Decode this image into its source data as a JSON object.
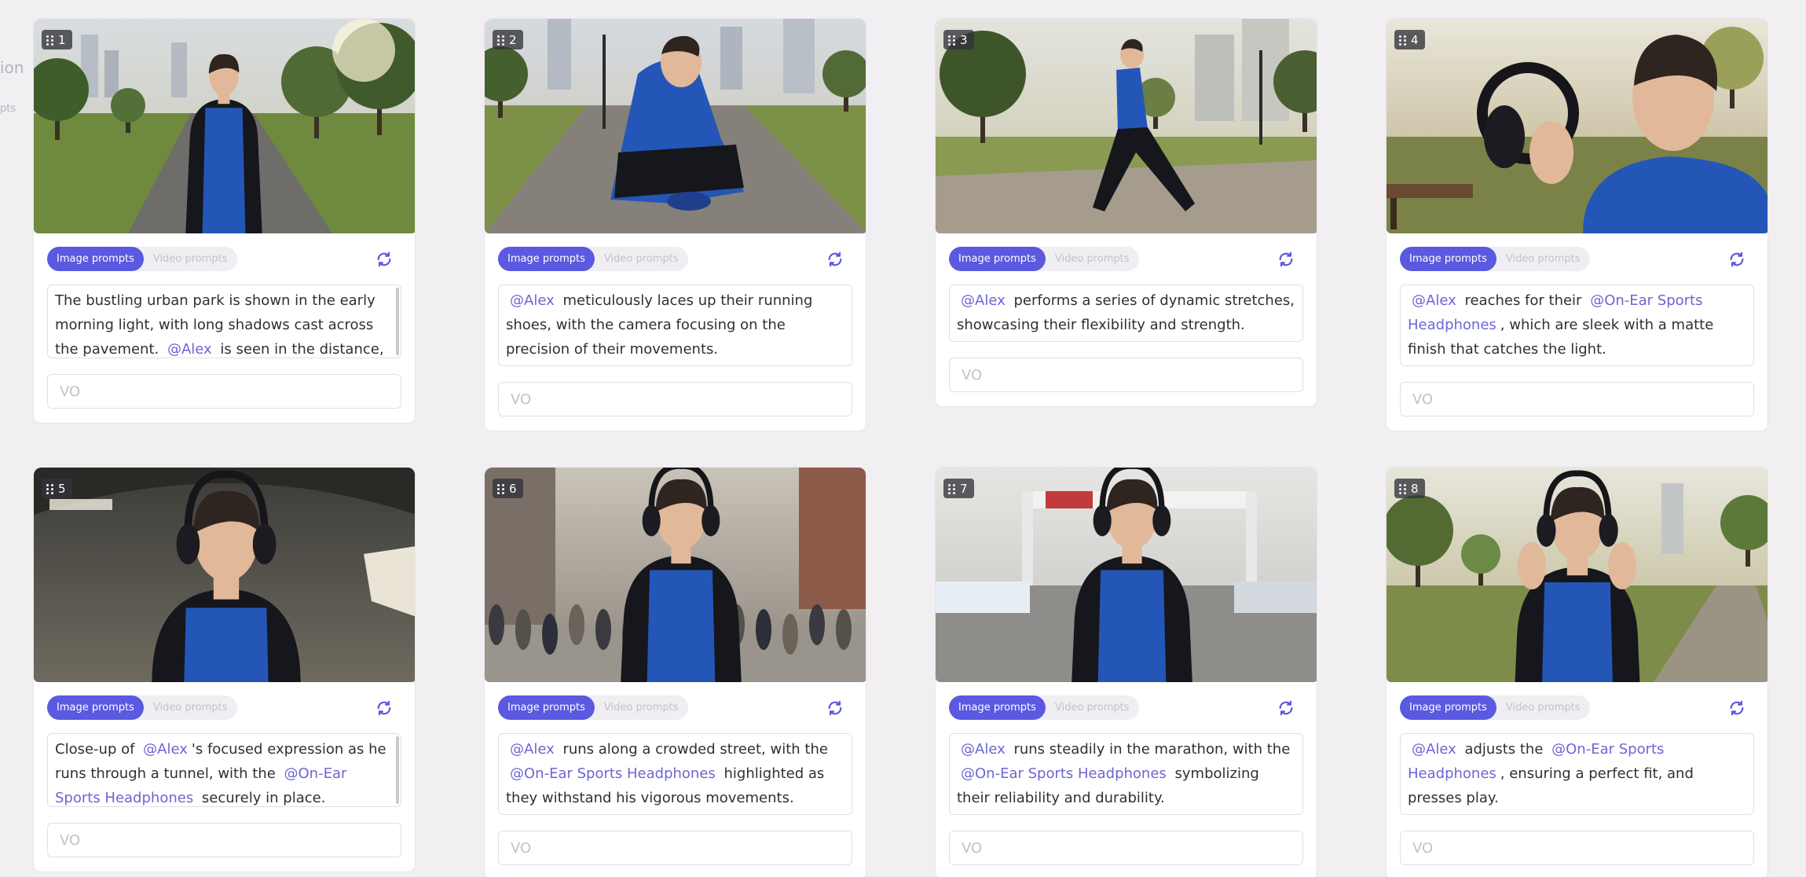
{
  "sidebar_fragments": [
    "ion",
    "pts"
  ],
  "tabs": {
    "image": "Image prompts",
    "video": "Video prompts"
  },
  "vo_placeholder": "VO",
  "colors": {
    "accent": "#5b59e0",
    "mention": "#6c66d2",
    "background": "#f1eff2"
  },
  "cards": [
    {
      "number": "1",
      "scene": "park-walk",
      "prompt": [
        {
          "t": "The bustling urban park is shown in the early morning light, with long shadows cast across the pavement. "
        },
        {
          "m": "@Alex"
        },
        {
          "t": " is seen in the distance,"
        }
      ]
    },
    {
      "number": "2",
      "scene": "tying-shoes",
      "prompt": [
        {
          "m": "@Alex"
        },
        {
          "t": " meticulously laces up their running shoes, with the camera focusing on the precision of their movements."
        }
      ]
    },
    {
      "number": "3",
      "scene": "stretching",
      "prompt": [
        {
          "m": "@Alex"
        },
        {
          "t": " performs a series of dynamic stretches, showcasing their flexibility and strength."
        }
      ]
    },
    {
      "number": "4",
      "scene": "holding-headphones",
      "prompt": [
        {
          "m": "@Alex"
        },
        {
          "t": " reaches for their "
        },
        {
          "m": "@On-Ear Sports Headphones"
        },
        {
          "t": ", which are sleek with a matte finish that catches the light."
        }
      ]
    },
    {
      "number": "5",
      "scene": "tunnel-closeup",
      "prompt": [
        {
          "t": "Close-up of "
        },
        {
          "m": "@Alex"
        },
        {
          "t": "'s focused expression as he runs through a tunnel, with the "
        },
        {
          "m": "@On-Ear Sports Headphones"
        },
        {
          "t": " securely in place."
        }
      ]
    },
    {
      "number": "6",
      "scene": "street-run",
      "prompt": [
        {
          "m": "@Alex"
        },
        {
          "t": " runs along a crowded street, with the "
        },
        {
          "m": "@On-Ear Sports Headphones"
        },
        {
          "t": " highlighted as they withstand his vigorous movements."
        }
      ]
    },
    {
      "number": "7",
      "scene": "marathon",
      "prompt": [
        {
          "m": "@Alex"
        },
        {
          "t": " runs steadily in the marathon, with the "
        },
        {
          "m": "@On-Ear Sports Headphones"
        },
        {
          "t": " symbolizing their reliability and durability."
        }
      ]
    },
    {
      "number": "8",
      "scene": "adjusting-headphones",
      "prompt": [
        {
          "m": "@Alex"
        },
        {
          "t": " adjusts the "
        },
        {
          "m": "@On-Ear Sports Headphones"
        },
        {
          "t": ", ensuring a perfect fit, and presses play."
        }
      ]
    }
  ]
}
